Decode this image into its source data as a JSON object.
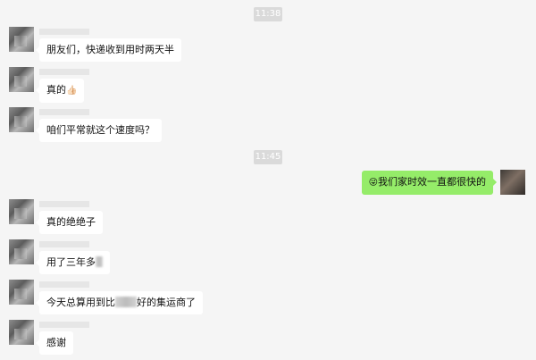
{
  "timestamps": [
    "11:38",
    "11:45"
  ],
  "messages": [
    {
      "text": "朋友们，快递收到用时两天半"
    },
    {
      "text": "真的",
      "emoji": "👍🏻"
    },
    {
      "text": "咱们平常就这个速度吗？"
    },
    {
      "text": "我们家时效一直都很快的",
      "emoji": "😜"
    },
    {
      "text": "真的绝绝子"
    },
    {
      "text": "用了三年多"
    },
    {
      "text_before": "今天总算用到比",
      "text_after": "好的集运商了"
    },
    {
      "text": "感谢"
    }
  ]
}
